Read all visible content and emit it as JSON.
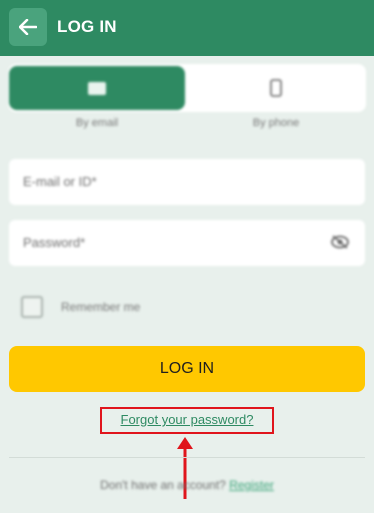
{
  "header": {
    "title": "LOG IN"
  },
  "tabs": [
    {
      "label": "By email"
    },
    {
      "label": "By phone"
    }
  ],
  "form": {
    "email_placeholder": "E-mail or ID*",
    "password_placeholder": "Password*",
    "remember_label": "Remember me",
    "login_label": "LOG IN",
    "forgot_label": "Forgot your password?"
  },
  "footer": {
    "prompt": "Don't have an account?",
    "register_label": "Register"
  },
  "colors": {
    "header": "#2e8a62",
    "accent_button": "#ffc800",
    "link": "#2e8a62",
    "highlight": "#e0151c"
  }
}
